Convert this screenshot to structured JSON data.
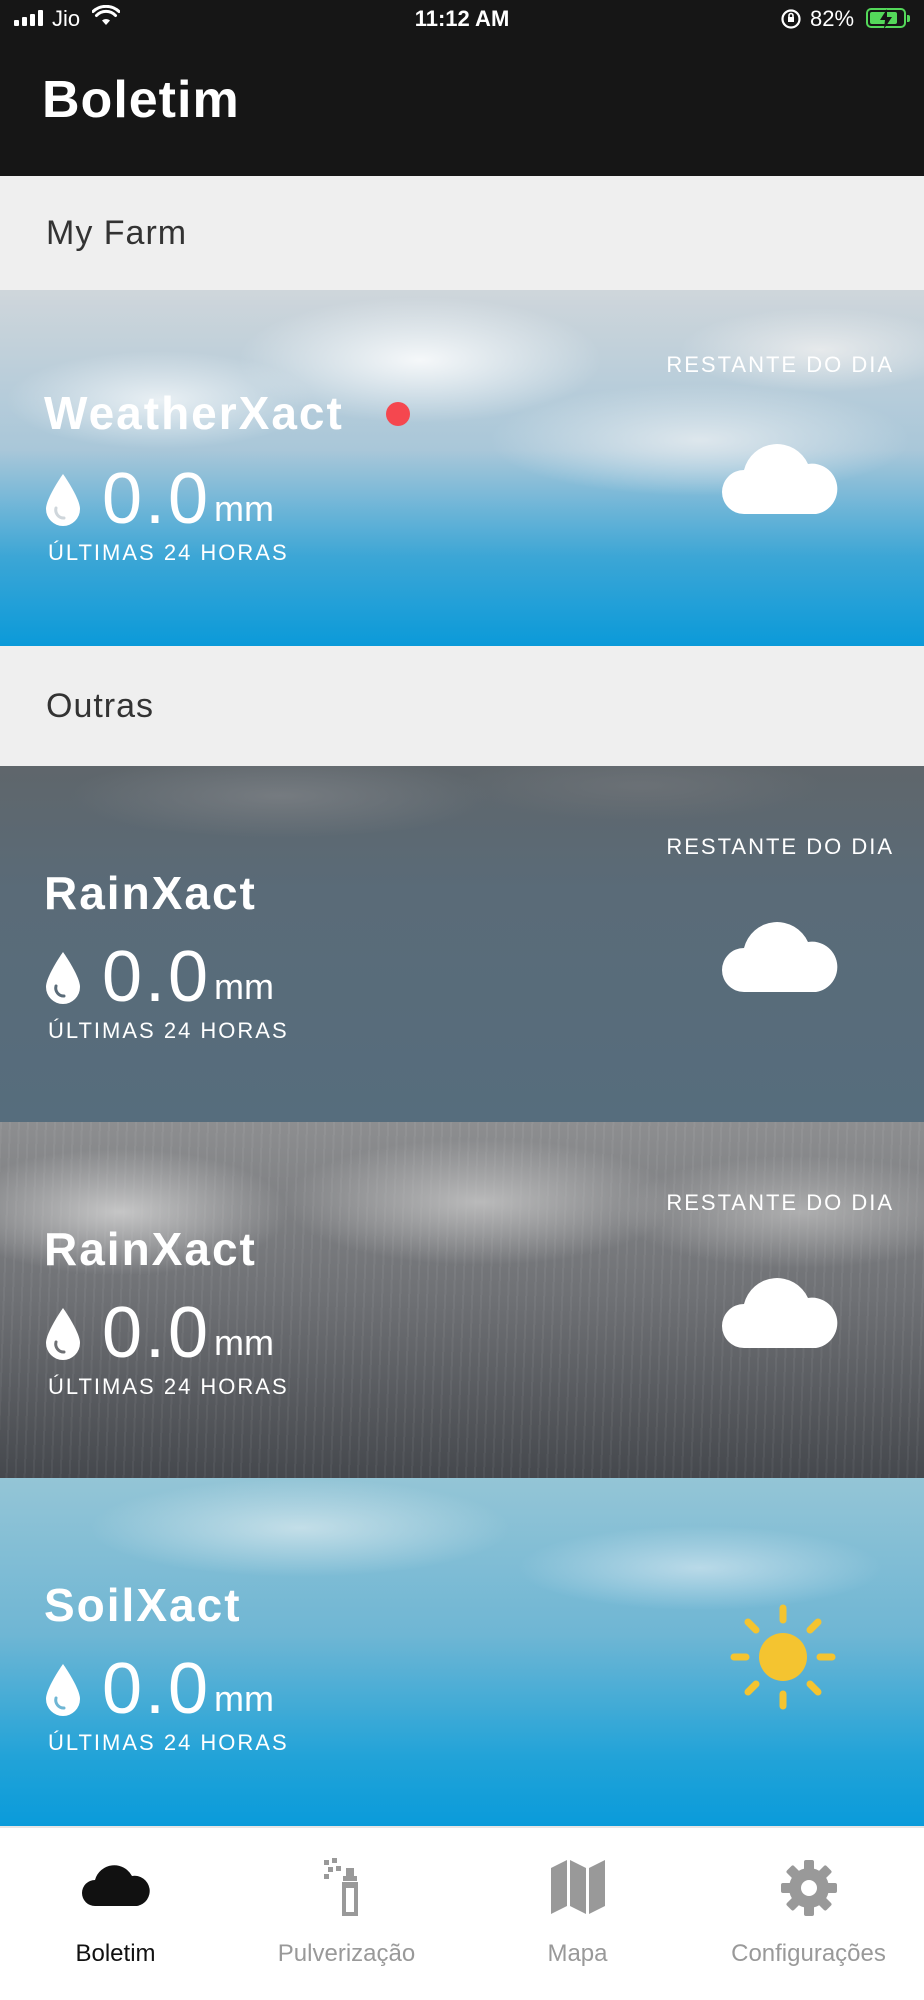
{
  "status_bar": {
    "carrier": "Jio",
    "time": "11:12 AM",
    "battery_percent": "82%"
  },
  "header": {
    "title": "Boletim"
  },
  "sections": {
    "my_farm": "My Farm",
    "others": "Outras"
  },
  "cards": [
    {
      "name": "WeatherXact",
      "remaining_label": "RESTANTE DO DIA",
      "value": "0.0",
      "unit": "mm",
      "period": "ÚLTIMAS 24 HORAS",
      "weather_icon": "cloud-icon",
      "alert": true
    },
    {
      "name": "RainXact",
      "remaining_label": "RESTANTE DO DIA",
      "value": "0.0",
      "unit": "mm",
      "period": "ÚLTIMAS 24 HORAS",
      "weather_icon": "cloud-icon"
    },
    {
      "name": "RainXact",
      "remaining_label": "RESTANTE DO DIA",
      "value": "0.0",
      "unit": "mm",
      "period": "ÚLTIMAS 24 HORAS",
      "weather_icon": "cloud-icon"
    },
    {
      "name": "SoilXact",
      "value": "0.0",
      "unit": "mm",
      "period": "ÚLTIMAS 24 HORAS",
      "weather_icon": "sun-icon"
    }
  ],
  "nav": [
    {
      "label": "Boletim",
      "icon": "cloud-icon",
      "active": true
    },
    {
      "label": "Pulverização",
      "icon": "sprayer-icon"
    },
    {
      "label": "Mapa",
      "icon": "map-icon"
    },
    {
      "label": "Configurações",
      "icon": "gear-icon"
    }
  ],
  "colors": {
    "header_bg": "#161616",
    "section_bg": "#efefef",
    "alert_dot": "#f5474f",
    "sun": "#f4c430",
    "battery": "#54d85a",
    "nav_active": "#111111",
    "nav_inactive": "#999999"
  }
}
